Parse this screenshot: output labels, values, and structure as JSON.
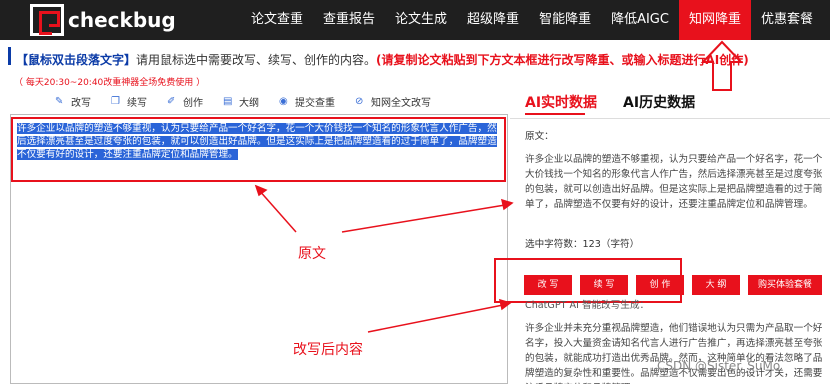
{
  "brand": {
    "name": "checkbug"
  },
  "nav": {
    "items": [
      "论文查重",
      "查重报告",
      "论文生成",
      "超级降重",
      "智能降重",
      "降低AIGC",
      "知网降重",
      "优惠套餐"
    ],
    "active_index": 6
  },
  "hint": {
    "blue": "【鼠标双击段落文字】",
    "normal": "请用鼠标选中需要改写、续写、创作的内容。",
    "red": "(请复制论文粘贴到下方文本框进行改写降重、或输入标题进行AI创作)"
  },
  "free_notice": "（ 每天20:30~20:40改重神器全场免费使用 ）",
  "toolbar": {
    "items": [
      {
        "icon": "pen-icon",
        "label": "改写"
      },
      {
        "icon": "copy-icon",
        "label": "续写"
      },
      {
        "icon": "create-icon",
        "label": "创作"
      },
      {
        "icon": "outline-icon",
        "label": "大纲"
      },
      {
        "icon": "eye-icon",
        "label": "提交查重"
      },
      {
        "icon": "link-icon",
        "label": "知网全文改写"
      }
    ]
  },
  "editor": {
    "selected_text": "许多企业以品牌的塑造不够重视，认为只要给产品一个好名字，花一个大价钱找一个知名的形象代言人作广告，然后选择漂亮甚至是过度夸张的包装，就可以创造出好品牌。但是这实际上是把品牌塑造看的过于简单了，品牌塑造不仅要有好的设计，还要注重品牌定位和品牌管理。"
  },
  "annotations": {
    "original": "原文",
    "rewritten": "改写后内容"
  },
  "right_panel": {
    "tabs": [
      "AI实时数据",
      "AI历史数据"
    ],
    "original_label": "原文：",
    "original_text": "许多企业以品牌的塑造不够重视，认为只要给产品一个好名字，花一个大价钱找一个知名的形象代言人作广告，然后选择漂亮甚至是过度夸张的包装，就可以创造出好品牌。但是这实际上是把品牌塑造看的过于简单了，品牌塑造不仅要有好的设计，还要注重品牌定位和品牌管理。",
    "char_count": "选中字符数：123（字符）",
    "buttons": [
      "改 写",
      "续 写",
      "创 作",
      "大 纲",
      "购买体验套餐"
    ],
    "generated_label": "ChatGPT AI 智能改写生成：",
    "generated_text": "许多企业并未充分重视品牌塑造，他们错误地认为只需为产品取一个好名字，投入大量资金请知名代言人进行广告推广，再选择漂亮甚至夸张的包装，就能成功打造出优秀品牌。然而，这种简单化的看法忽略了品牌塑造的复杂性和重要性。品牌塑造不仅需要出色的设计才关，还需要注重品牌定位和品牌管理。"
  },
  "watermark": "CSDN @Sister_SuMo"
}
